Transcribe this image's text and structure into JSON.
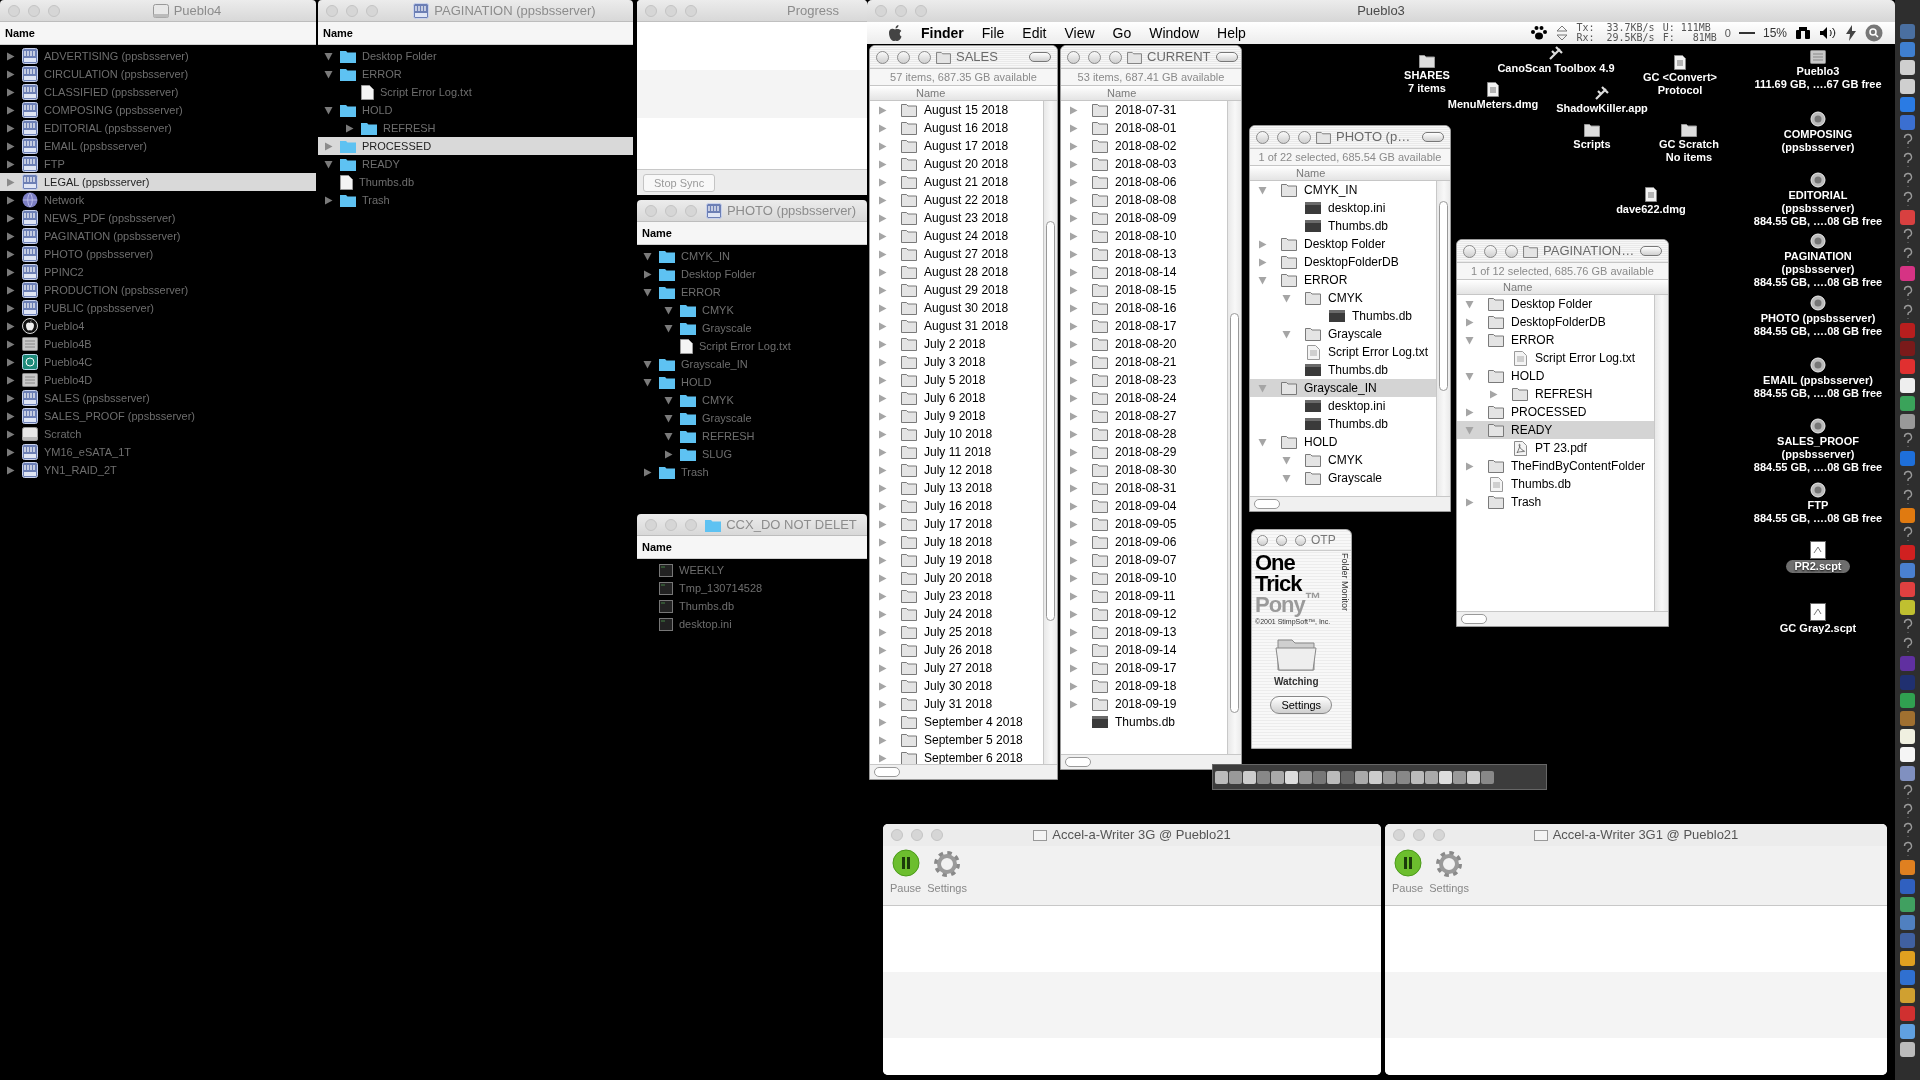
{
  "dark_windows": [
    {
      "title": "Pueblo4",
      "column": "Name",
      "rows": [
        {
          "name": "ADVERTISING (ppsbsserver)",
          "kind": "server",
          "expanded": false,
          "selected": false
        },
        {
          "name": "CIRCULATION (ppsbsserver)",
          "kind": "server",
          "expanded": false,
          "selected": false
        },
        {
          "name": "CLASSIFIED (ppsbsserver)",
          "kind": "server",
          "expanded": false,
          "selected": false
        },
        {
          "name": "COMPOSING (ppsbsserver)",
          "kind": "server",
          "expanded": false,
          "selected": false
        },
        {
          "name": "EDITORIAL (ppsbsserver)",
          "kind": "server",
          "expanded": false,
          "selected": false
        },
        {
          "name": "EMAIL (ppsbsserver)",
          "kind": "server",
          "expanded": false,
          "selected": false
        },
        {
          "name": "FTP",
          "kind": "server",
          "expanded": false,
          "selected": false
        },
        {
          "name": "LEGAL (ppsbsserver)",
          "kind": "server",
          "expanded": false,
          "selected": true
        },
        {
          "name": "Network",
          "kind": "network",
          "expanded": false,
          "selected": false
        },
        {
          "name": "NEWS_PDF (ppsbsserver)",
          "kind": "server",
          "expanded": false,
          "selected": false
        },
        {
          "name": "PAGINATION (ppsbsserver)",
          "kind": "server",
          "expanded": false,
          "selected": false
        },
        {
          "name": "PHOTO (ppsbsserver)",
          "kind": "server",
          "expanded": false,
          "selected": false
        },
        {
          "name": "PPINC2",
          "kind": "server",
          "expanded": false,
          "selected": false
        },
        {
          "name": "PRODUCTION (ppsbsserver)",
          "kind": "server",
          "expanded": false,
          "selected": false
        },
        {
          "name": "PUBLIC (ppsbsserver)",
          "kind": "server",
          "expanded": false,
          "selected": false
        },
        {
          "name": "Pueblo4",
          "kind": "startup",
          "expanded": false,
          "selected": false
        },
        {
          "name": "Pueblo4B",
          "kind": "drive",
          "expanded": false,
          "selected": false
        },
        {
          "name": "Pueblo4C",
          "kind": "backup",
          "expanded": false,
          "selected": false
        },
        {
          "name": "Pueblo4D",
          "kind": "drive",
          "expanded": false,
          "selected": false
        },
        {
          "name": "SALES (ppsbsserver)",
          "kind": "server",
          "expanded": false,
          "selected": false
        },
        {
          "name": "SALES_PROOF (ppsbsserver)",
          "kind": "server",
          "expanded": false,
          "selected": false
        },
        {
          "name": "Scratch",
          "kind": "disk",
          "expanded": false,
          "selected": false
        },
        {
          "name": "YM16_eSATA_1T",
          "kind": "server",
          "expanded": false,
          "selected": false
        },
        {
          "name": "YN1_RAID_2T",
          "kind": "server",
          "expanded": false,
          "selected": false
        }
      ]
    },
    {
      "title": "PAGINATION (ppsbsserver)",
      "column": "Name",
      "rows": [
        {
          "name": "Desktop Folder",
          "kind": "folder",
          "expanded": true,
          "selected": false
        },
        {
          "name": "ERROR",
          "kind": "folder",
          "expanded": true,
          "selected": false,
          "children": [
            {
              "name": "Script Error Log.txt",
              "kind": "file",
              "selected": false
            }
          ]
        },
        {
          "name": "HOLD",
          "kind": "folder",
          "expanded": true,
          "selected": false,
          "children": [
            {
              "name": "REFRESH",
              "kind": "folder",
              "expanded": false,
              "selected": false
            }
          ]
        },
        {
          "name": "PROCESSED",
          "kind": "folder",
          "expanded": false,
          "selected": true
        },
        {
          "name": "READY",
          "kind": "folder",
          "expanded": true,
          "selected": false
        },
        {
          "name": "Thumbs.db",
          "kind": "file",
          "selected": false
        },
        {
          "name": "Trash",
          "kind": "folder",
          "expanded": false,
          "selected": false
        }
      ]
    },
    {
      "title": "PHOTO (ppsbsserver)",
      "column": "Name",
      "rows": [
        {
          "name": "CMYK_IN",
          "kind": "folder",
          "expanded": true,
          "selected": false
        },
        {
          "name": "Desktop Folder",
          "kind": "folder",
          "expanded": false,
          "selected": false
        },
        {
          "name": "ERROR",
          "kind": "folder",
          "expanded": true,
          "selected": false,
          "children": [
            {
              "name": "CMYK",
              "kind": "folder",
              "expanded": true,
              "selected": false
            },
            {
              "name": "Grayscale",
              "kind": "folder",
              "expanded": true,
              "selected": false
            },
            {
              "name": "Script Error Log.txt",
              "kind": "file",
              "selected": false
            }
          ]
        },
        {
          "name": "Grayscale_IN",
          "kind": "folder",
          "expanded": true,
          "selected": false
        },
        {
          "name": "HOLD",
          "kind": "folder",
          "expanded": true,
          "selected": false,
          "children": [
            {
              "name": "CMYK",
              "kind": "folder",
              "expanded": true,
              "selected": false
            },
            {
              "name": "Grayscale",
              "kind": "folder",
              "expanded": true,
              "selected": false
            },
            {
              "name": "REFRESH",
              "kind": "folder",
              "expanded": true,
              "selected": false
            },
            {
              "name": "SLUG",
              "kind": "folder",
              "expanded": false,
              "selected": false
            }
          ]
        },
        {
          "name": "Trash",
          "kind": "folder",
          "expanded": false,
          "selected": false
        }
      ]
    },
    {
      "title": "CCX_DO NOT DELET",
      "column": "Name",
      "rows": [
        {
          "name": "WEEKLY",
          "kind": "terminal",
          "selected": false
        },
        {
          "name": "Tmp_130714528",
          "kind": "terminal",
          "selected": false
        },
        {
          "name": "Thumbs.db",
          "kind": "terminal",
          "selected": false
        },
        {
          "name": "desktop.ini",
          "kind": "terminal",
          "selected": false
        }
      ]
    }
  ],
  "progress_window": {
    "title": "Progress",
    "button": "Stop Sync"
  },
  "remote_window": {
    "title": "Pueblo3"
  },
  "menu_bar": {
    "items": [
      "Finder",
      "File",
      "Edit",
      "View",
      "Go",
      "Window",
      "Help"
    ],
    "tx": "Tx:  33.7KB/s",
    "rx": "Rx:  29.5KB/s",
    "used": "U: 111MB",
    "free": "F:   81MB",
    "counter": "0",
    "percent": "15%"
  },
  "classic_windows": [
    {
      "title": "SALES",
      "status": "57 items, 687.35 GB available",
      "column": "Name",
      "rows": [
        {
          "name": "August 15 2018",
          "kind": "folder",
          "expanded": false,
          "selected": false
        },
        {
          "name": "August 16 2018",
          "kind": "folder",
          "expanded": false,
          "selected": false
        },
        {
          "name": "August 17 2018",
          "kind": "folder",
          "expanded": false,
          "selected": false
        },
        {
          "name": "August 20 2018",
          "kind": "folder",
          "expanded": false,
          "selected": false
        },
        {
          "name": "August 21 2018",
          "kind": "folder",
          "expanded": false,
          "selected": false
        },
        {
          "name": "August 22 2018",
          "kind": "folder",
          "expanded": false,
          "selected": false
        },
        {
          "name": "August 23 2018",
          "kind": "folder",
          "expanded": false,
          "selected": false
        },
        {
          "name": "August 24 2018",
          "kind": "folder",
          "expanded": false,
          "selected": false
        },
        {
          "name": "August 27 2018",
          "kind": "folder",
          "expanded": false,
          "selected": false
        },
        {
          "name": "August 28 2018",
          "kind": "folder",
          "expanded": false,
          "selected": false
        },
        {
          "name": "August 29 2018",
          "kind": "folder",
          "expanded": false,
          "selected": false
        },
        {
          "name": "August 30 2018",
          "kind": "folder",
          "expanded": false,
          "selected": false
        },
        {
          "name": "August 31 2018",
          "kind": "folder",
          "expanded": false,
          "selected": false
        },
        {
          "name": "July 2 2018",
          "kind": "folder",
          "expanded": false,
          "selected": false
        },
        {
          "name": "July 3 2018",
          "kind": "folder",
          "expanded": false,
          "selected": false
        },
        {
          "name": "July 5 2018",
          "kind": "folder",
          "expanded": false,
          "selected": false
        },
        {
          "name": "July 6 2018",
          "kind": "folder",
          "expanded": false,
          "selected": false
        },
        {
          "name": "July 9 2018",
          "kind": "folder",
          "expanded": false,
          "selected": false
        },
        {
          "name": "July 10 2018",
          "kind": "folder",
          "expanded": false,
          "selected": false
        },
        {
          "name": "July 11 2018",
          "kind": "folder",
          "expanded": false,
          "selected": false
        },
        {
          "name": "July 12 2018",
          "kind": "folder",
          "expanded": false,
          "selected": false
        },
        {
          "name": "July 13 2018",
          "kind": "folder",
          "expanded": false,
          "selected": false
        },
        {
          "name": "July 16 2018",
          "kind": "folder",
          "expanded": false,
          "selected": false
        },
        {
          "name": "July 17 2018",
          "kind": "folder",
          "expanded": false,
          "selected": false
        },
        {
          "name": "July 18 2018",
          "kind": "folder",
          "expanded": false,
          "selected": false
        },
        {
          "name": "July 19 2018",
          "kind": "folder",
          "expanded": false,
          "selected": false
        },
        {
          "name": "July 20 2018",
          "kind": "folder",
          "expanded": false,
          "selected": false
        },
        {
          "name": "July 23 2018",
          "kind": "folder",
          "expanded": false,
          "selected": false
        },
        {
          "name": "July 24 2018",
          "kind": "folder",
          "expanded": false,
          "selected": false
        },
        {
          "name": "July 25 2018",
          "kind": "folder",
          "expanded": false,
          "selected": false
        },
        {
          "name": "July 26 2018",
          "kind": "folder",
          "expanded": false,
          "selected": false
        },
        {
          "name": "July 27 2018",
          "kind": "folder",
          "expanded": false,
          "selected": false
        },
        {
          "name": "July 30 2018",
          "kind": "folder",
          "expanded": false,
          "selected": false
        },
        {
          "name": "July 31 2018",
          "kind": "folder",
          "expanded": false,
          "selected": false
        },
        {
          "name": "September 4 2018",
          "kind": "folder",
          "expanded": false,
          "selected": false
        },
        {
          "name": "September 5 2018",
          "kind": "folder",
          "expanded": false,
          "selected": false
        },
        {
          "name": "September 6 2018",
          "kind": "folder",
          "expanded": false,
          "selected": false
        }
      ]
    },
    {
      "title": "CURRENT",
      "status": "53 items, 687.41 GB available",
      "column": "Name",
      "rows": [
        {
          "name": "2018-07-31",
          "kind": "folder",
          "expanded": false,
          "selected": false
        },
        {
          "name": "2018-08-01",
          "kind": "folder",
          "expanded": false,
          "selected": false
        },
        {
          "name": "2018-08-02",
          "kind": "folder",
          "expanded": false,
          "selected": false
        },
        {
          "name": "2018-08-03",
          "kind": "folder",
          "expanded": false,
          "selected": false
        },
        {
          "name": "2018-08-06",
          "kind": "folder",
          "expanded": false,
          "selected": false
        },
        {
          "name": "2018-08-08",
          "kind": "folder",
          "expanded": false,
          "selected": false
        },
        {
          "name": "2018-08-09",
          "kind": "folder",
          "expanded": false,
          "selected": false
        },
        {
          "name": "2018-08-10",
          "kind": "folder",
          "expanded": false,
          "selected": false
        },
        {
          "name": "2018-08-13",
          "kind": "folder",
          "expanded": false,
          "selected": false
        },
        {
          "name": "2018-08-14",
          "kind": "folder",
          "expanded": false,
          "selected": false
        },
        {
          "name": "2018-08-15",
          "kind": "folder",
          "expanded": false,
          "selected": false
        },
        {
          "name": "2018-08-16",
          "kind": "folder",
          "expanded": false,
          "selected": false
        },
        {
          "name": "2018-08-17",
          "kind": "folder",
          "expanded": false,
          "selected": false
        },
        {
          "name": "2018-08-20",
          "kind": "folder",
          "expanded": false,
          "selected": false
        },
        {
          "name": "2018-08-21",
          "kind": "folder",
          "expanded": false,
          "selected": false
        },
        {
          "name": "2018-08-23",
          "kind": "folder",
          "expanded": false,
          "selected": false
        },
        {
          "name": "2018-08-24",
          "kind": "folder",
          "expanded": false,
          "selected": false
        },
        {
          "name": "2018-08-27",
          "kind": "folder",
          "expanded": false,
          "selected": false
        },
        {
          "name": "2018-08-28",
          "kind": "folder",
          "expanded": false,
          "selected": false
        },
        {
          "name": "2018-08-29",
          "kind": "folder",
          "expanded": false,
          "selected": false
        },
        {
          "name": "2018-08-30",
          "kind": "folder",
          "expanded": false,
          "selected": false
        },
        {
          "name": "2018-08-31",
          "kind": "folder",
          "expanded": false,
          "selected": false
        },
        {
          "name": "2018-09-04",
          "kind": "folder",
          "expanded": false,
          "selected": false
        },
        {
          "name": "2018-09-05",
          "kind": "folder",
          "expanded": false,
          "selected": false
        },
        {
          "name": "2018-09-06",
          "kind": "folder",
          "expanded": false,
          "selected": false
        },
        {
          "name": "2018-09-07",
          "kind": "folder",
          "expanded": false,
          "selected": false
        },
        {
          "name": "2018-09-10",
          "kind": "folder",
          "expanded": false,
          "selected": false
        },
        {
          "name": "2018-09-11",
          "kind": "folder",
          "expanded": false,
          "selected": false
        },
        {
          "name": "2018-09-12",
          "kind": "folder",
          "expanded": false,
          "selected": false
        },
        {
          "name": "2018-09-13",
          "kind": "folder",
          "expanded": false,
          "selected": false
        },
        {
          "name": "2018-09-14",
          "kind": "folder",
          "expanded": false,
          "selected": false
        },
        {
          "name": "2018-09-17",
          "kind": "folder",
          "expanded": false,
          "selected": false
        },
        {
          "name": "2018-09-18",
          "kind": "folder",
          "expanded": false,
          "selected": false
        },
        {
          "name": "2018-09-19",
          "kind": "folder",
          "expanded": false,
          "selected": false
        },
        {
          "name": "Thumbs.db",
          "kind": "dbfile",
          "selected": false
        }
      ]
    },
    {
      "title": "PHOTO (p…",
      "status": "1 of 22 selected, 685.54 GB available",
      "column": "Name",
      "rows": [
        {
          "name": "CMYK_IN",
          "kind": "folder",
          "expanded": true,
          "selected": false,
          "children": [
            {
              "name": "desktop.ini",
              "kind": "dbfile",
              "selected": false
            },
            {
              "name": "Thumbs.db",
              "kind": "dbfile",
              "selected": false
            }
          ]
        },
        {
          "name": "Desktop Folder",
          "kind": "folder",
          "expanded": false,
          "selected": false
        },
        {
          "name": "DesktopFolderDB",
          "kind": "folder",
          "expanded": false,
          "selected": false
        },
        {
          "name": "ERROR",
          "kind": "folder",
          "expanded": true,
          "selected": false,
          "children": [
            {
              "name": "CMYK",
              "kind": "folder",
              "expanded": true,
              "selected": false,
              "children": [
                {
                  "name": "Thumbs.db",
                  "kind": "dbfile",
                  "selected": false
                }
              ]
            },
            {
              "name": "Grayscale",
              "kind": "folder",
              "expanded": true,
              "selected": false
            },
            {
              "name": "Script Error Log.txt",
              "kind": "file",
              "selected": false
            },
            {
              "name": "Thumbs.db",
              "kind": "dbfile",
              "selected": false
            }
          ]
        },
        {
          "name": "Grayscale_IN",
          "kind": "folder",
          "expanded": true,
          "selected": true,
          "children": [
            {
              "name": "desktop.ini",
              "kind": "dbfile",
              "selected": false
            },
            {
              "name": "Thumbs.db",
              "kind": "dbfile",
              "selected": false
            }
          ]
        },
        {
          "name": "HOLD",
          "kind": "folder",
          "expanded": true,
          "selected": false,
          "children": [
            {
              "name": "CMYK",
              "kind": "folder",
              "expanded": true,
              "selected": false
            },
            {
              "name": "Grayscale",
              "kind": "folder",
              "expanded": true,
              "selected": false
            }
          ]
        }
      ]
    },
    {
      "title": "PAGINATION…",
      "status": "1 of 12 selected, 685.76 GB available",
      "column": "Name",
      "rows": [
        {
          "name": "Desktop Folder",
          "kind": "folder",
          "expanded": true,
          "selected": false
        },
        {
          "name": "DesktopFolderDB",
          "kind": "folder",
          "expanded": false,
          "selected": false
        },
        {
          "name": "ERROR",
          "kind": "folder",
          "expanded": true,
          "selected": false,
          "children": [
            {
              "name": "Script Error Log.txt",
              "kind": "file",
              "selected": false
            }
          ]
        },
        {
          "name": "HOLD",
          "kind": "folder",
          "expanded": true,
          "selected": false,
          "children": [
            {
              "name": "REFRESH",
              "kind": "folder",
              "expanded": false,
              "selected": false
            }
          ]
        },
        {
          "name": "PROCESSED",
          "kind": "folder",
          "expanded": false,
          "selected": false
        },
        {
          "name": "READY",
          "kind": "folder",
          "expanded": true,
          "selected": true,
          "children": [
            {
              "name": "PT 23.pdf",
              "kind": "pdf",
              "selected": false
            }
          ]
        },
        {
          "name": "TheFindByContentFolder",
          "kind": "folder",
          "expanded": false,
          "selected": false
        },
        {
          "name": "Thumbs.db",
          "kind": "file",
          "selected": false
        },
        {
          "name": "Trash",
          "kind": "folder",
          "expanded": false,
          "selected": false
        }
      ]
    }
  ],
  "otp_window": {
    "title": "OTP",
    "logo": [
      "One",
      "Trick",
      "Pony$^{™}$"
    ],
    "side_label": "Folder Monitor",
    "copyright": "©2001 StimpSoft™, Inc.",
    "status": "Watching",
    "button": "Settings"
  },
  "desktop_icons": [
    {
      "lines": [
        "SHARES",
        "7 items"
      ],
      "kind": "folder",
      "selected": false
    },
    {
      "lines": [
        "CanoScan Toolbox 4.9"
      ],
      "kind": "app",
      "selected": false
    },
    {
      "lines": [
        "MenuMeters.dmg"
      ],
      "kind": "doc",
      "selected": false
    },
    {
      "lines": [
        "ShadowKiller.app"
      ],
      "kind": "app",
      "selected": false
    },
    {
      "lines": [
        "GC <Convert>",
        "Protocol"
      ],
      "kind": "doc",
      "selected": false
    },
    {
      "lines": [
        "Scripts"
      ],
      "kind": "folder",
      "selected": false
    },
    {
      "lines": [
        "GC Scratch",
        "No items"
      ],
      "kind": "folder",
      "selected": false
    },
    {
      "lines": [
        "dave622.dmg"
      ],
      "kind": "doc",
      "selected": false
    },
    {
      "lines": [
        "Pueblo3",
        "111.69 GB, ….67 GB free"
      ],
      "kind": "drive",
      "selected": false
    },
    {
      "lines": [
        "COMPOSING",
        "(ppsbsserver)"
      ],
      "kind": "server",
      "selected": false
    },
    {
      "lines": [
        "EDITORIAL",
        "(ppsbsserver)",
        "884.55 GB, ….08 GB free"
      ],
      "kind": "server",
      "selected": false
    },
    {
      "lines": [
        "PAGINATION",
        "(ppsbsserver)",
        "884.55 GB, ….08 GB free"
      ],
      "kind": "server",
      "selected": false
    },
    {
      "lines": [
        "PHOTO (ppsbsserver)",
        "884.55 GB, ….08 GB free"
      ],
      "kind": "server",
      "selected": false
    },
    {
      "lines": [
        "EMAIL (ppsbsserver)",
        "884.55 GB, ….08 GB free"
      ],
      "kind": "server",
      "selected": false
    },
    {
      "lines": [
        "SALES_PROOF",
        "(ppsbsserver)",
        "884.55 GB, ….08 GB free"
      ],
      "kind": "server",
      "selected": false
    },
    {
      "lines": [
        "FTP",
        "884.55 GB, ….08 GB free"
      ],
      "kind": "server",
      "selected": false
    },
    {
      "lines": [
        "PR2.scpt"
      ],
      "kind": "script",
      "selected": true
    },
    {
      "lines": [
        "GC Gray2.scpt"
      ],
      "kind": "script",
      "selected": false
    }
  ],
  "accel_windows": [
    {
      "title": "Accel-a-Writer 3G @ Pueblo21",
      "pause": "Pause",
      "settings": "Settings"
    },
    {
      "title": "Accel-a-Writer 3G1 @ Pueblo21",
      "pause": "Pause",
      "settings": "Settings"
    }
  ]
}
